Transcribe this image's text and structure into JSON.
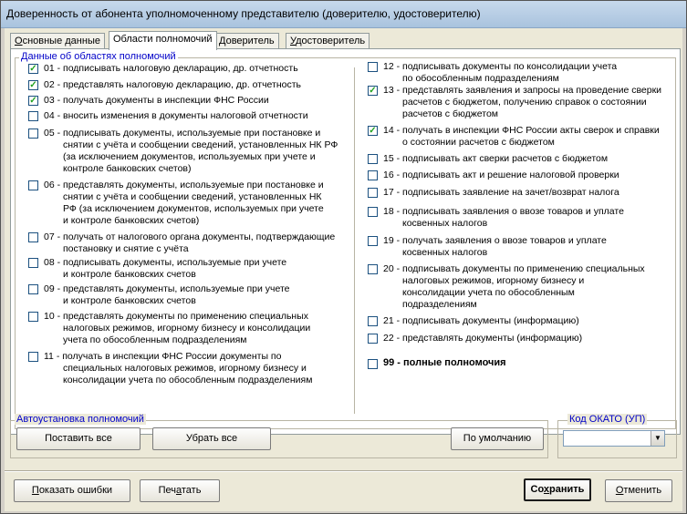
{
  "window": {
    "title": "Доверенность от абонента уполномоченному представителю (доверителю, удостоверителю)"
  },
  "tabs": [
    {
      "label": "Основные данные",
      "ul": "О",
      "rest": "сновные данные"
    },
    {
      "label": "Области полномочий",
      "ul": "",
      "rest": "Области полномочий"
    },
    {
      "label": "Доверитель",
      "ul": "Д",
      "rest": "оверитель"
    },
    {
      "label": "Удостоверитель",
      "ul": "У",
      "rest": "достоверитель"
    }
  ],
  "group": {
    "title": "Данные об областях полномочий"
  },
  "left_items": [
    {
      "checked": true,
      "lines": [
        "01 - подписывать налоговую декларацию, др. отчетность"
      ]
    },
    {
      "checked": true,
      "lines": [
        "02 - представлять налоговую декларацию, др. отчетность"
      ]
    },
    {
      "checked": true,
      "lines": [
        "03 - получать документы в инспекции ФНС России"
      ]
    },
    {
      "checked": false,
      "lines": [
        "04 - вносить изменения в документы налоговой отчетности"
      ]
    },
    {
      "checked": false,
      "lines": [
        "05 - подписывать документы, используемые при постановке и",
        "снятии с учёта и сообщении сведений, установленных НК РФ",
        "(за исключением документов, используемых при  учете и",
        "контроле банковских счетов)"
      ]
    },
    {
      "checked": false,
      "lines": [
        "06 - представлять документы, используемые при постановке и",
        "снятии с учёта и сообщении сведений, установленных НК",
        "РФ (за исключением документов,  используемых при  учете",
        "и контроле банковских счетов)"
      ]
    },
    {
      "checked": false,
      "lines": [
        "07 - получать от налогового органа документы, подтверждающие",
        "постановку и снятие с учёта"
      ]
    },
    {
      "checked": false,
      "lines": [
        "08 - подписывать документы, используемые при  учете",
        "и контроле банковских счетов"
      ]
    },
    {
      "checked": false,
      "lines": [
        "09 - представлять документы, используемые при  учете",
        "и контроле банковских счетов"
      ]
    },
    {
      "checked": false,
      "lines": [
        "10 - представлять документы по применению специальных",
        "налоговых режимов, игорному бизнесу и консолидации",
        "учета по обособленным подразделениям"
      ]
    },
    {
      "checked": false,
      "lines": [
        "11 - получать в инспекции ФНС России документы по",
        "специальных налоговых режимов, игорному бизнесу  и",
        "консолидации учета по обособленным подразделениям"
      ]
    }
  ],
  "right_items": [
    {
      "checked": false,
      "lines": [
        "12 - подписывать документы по консолидации учета",
        "по обособленным подразделениям"
      ]
    },
    {
      "checked": true,
      "lines": [
        "13 - представлять заявления и запросы на проведение сверки",
        "расчетов с бюджетом, получению справок о состоянии",
        "расчетов с бюджетом"
      ]
    },
    {
      "checked": true,
      "lines": [
        "14 - получать в инспекции ФНС России акты сверок и справки",
        "о состоянии расчетов с бюджетом"
      ]
    },
    {
      "checked": false,
      "lines": [
        "15 - подписывать акт сверки расчетов с бюджетом"
      ]
    },
    {
      "checked": false,
      "lines": [
        "16 - подписывать акт и решение налоговой проверки"
      ]
    },
    {
      "checked": false,
      "lines": [
        "17 - подписывать заявление на зачет/возврат налога"
      ]
    },
    {
      "checked": false,
      "lines": [
        "18 - подписывать заявления о ввозе товаров и уплате",
        "косвенных налогов"
      ]
    },
    {
      "checked": false,
      "lines": [
        "19 - получать заявления о ввозе товаров и уплате",
        "косвенных налогов"
      ]
    },
    {
      "checked": false,
      "lines": [
        "20 - подписывать документы по применению специальных",
        "налоговых режимов, игорному бизнесу и",
        "консолидации учета по обособленным",
        "подразделениям"
      ]
    },
    {
      "checked": false,
      "lines": [
        "21 - подписывать документы (информацию)"
      ]
    },
    {
      "checked": false,
      "lines": [
        "22 - представлять документы (информацию)"
      ]
    },
    {
      "checked": false,
      "bold": true,
      "lines": [
        "99 - полные полномочия"
      ]
    }
  ],
  "auto": {
    "title": "Автоустановка полномочий",
    "set_all": "Поставить все",
    "clear_all": "Убрать все",
    "default": "По умолчанию"
  },
  "okato": {
    "title": "Код ОКАТО (УП)",
    "value": ""
  },
  "footer": {
    "show_errors": {
      "ul": "П",
      "rest": "оказать ошибки"
    },
    "print": {
      "pre": "Печ",
      "ul": "а",
      "rest": "тать"
    },
    "save": {
      "pre": "Со",
      "ul": "х",
      "rest": "ранить"
    },
    "cancel": {
      "ul": "О",
      "rest": "тменить"
    }
  },
  "check_glyph": "✓"
}
